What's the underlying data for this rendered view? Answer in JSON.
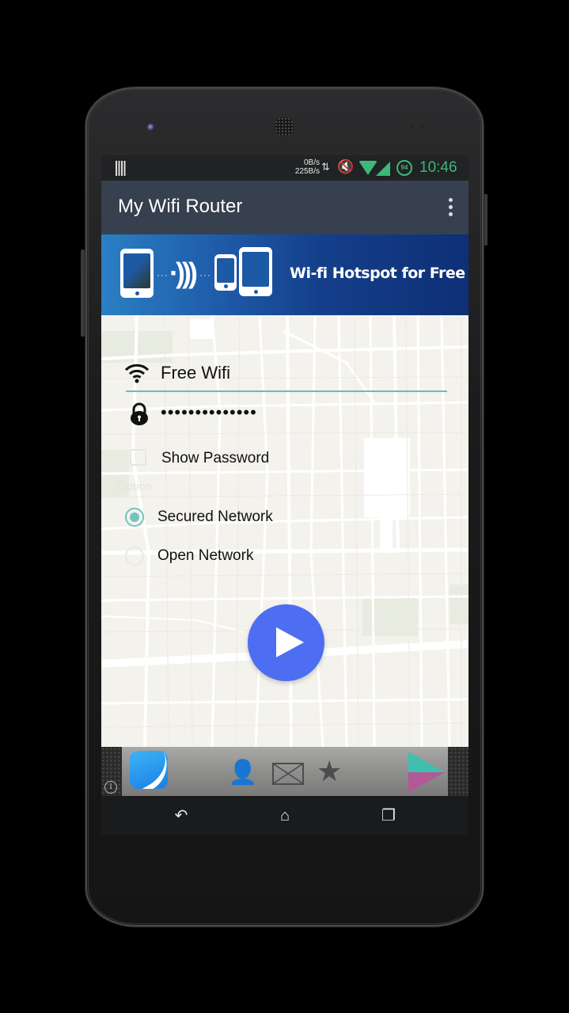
{
  "statusbar": {
    "notification_icon": "barcode-notification-icon",
    "speed_up": "0B/s",
    "speed_down": "225B/s",
    "data_icon": "data-transfer-icon",
    "mute_icon": "volume-mute-icon",
    "wifi_icon": "wifi-signal-icon",
    "cell_icon": "cell-signal-icon",
    "battery_level": "94",
    "time": "10:46",
    "accent_color": "#3cb878"
  },
  "appbar": {
    "title": "My Wifi Router",
    "menu_icon": "overflow-menu-icon",
    "background": "#37404e"
  },
  "banner": {
    "text": "Wi-fi Hotspot for Free"
  },
  "form": {
    "ssid_value": "Free Wifi",
    "password_value": "••••••••••••••",
    "show_password_label": "Show Password",
    "show_password_checked": false,
    "option_label": "Option",
    "radio_options": [
      {
        "label": "Secured Network",
        "selected": true
      },
      {
        "label": "Open Network",
        "selected": false
      }
    ],
    "accent_color": "#6bbcb8"
  },
  "fab": {
    "icon": "play-icon",
    "color": "#4e6ef2"
  },
  "ad": {
    "info_symbol": "i",
    "person_symbol": "👤",
    "star_symbol": "★"
  },
  "navbar": {
    "back_symbol": "↶",
    "home_symbol": "⌂",
    "recents_symbol": "❐"
  }
}
